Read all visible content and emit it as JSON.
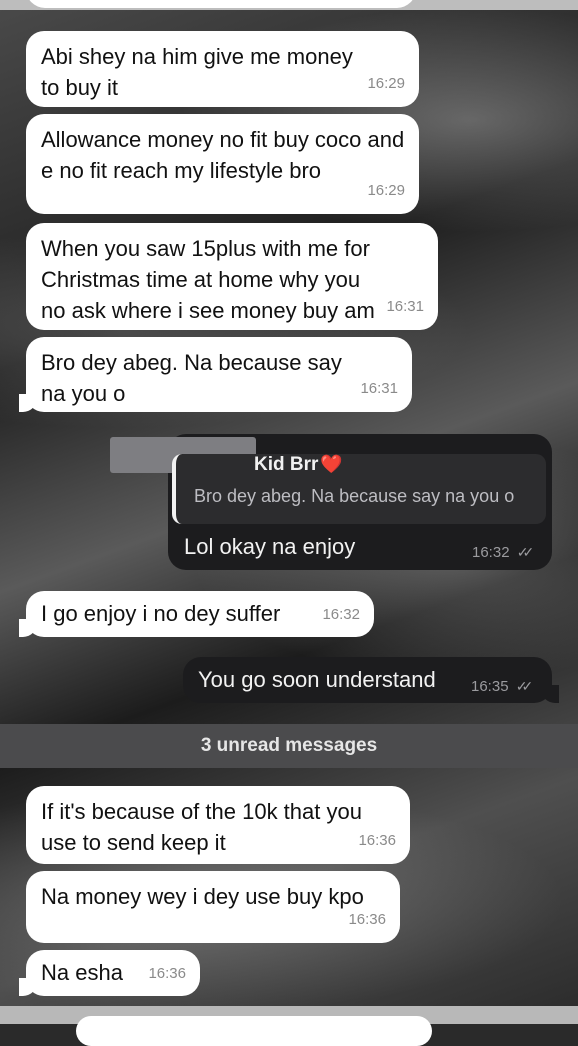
{
  "messages": [
    {
      "text": "Abi shey na him give me money to buy it",
      "time": "16:29"
    },
    {
      "text": "Allowance money no fit buy coco and e no fit reach my lifestyle bro",
      "time": "16:29"
    },
    {
      "text": "When you saw 15plus with me for Christmas time at home why you no ask where i see money buy am",
      "time": "16:31"
    },
    {
      "text": "Bro dey abeg. Na because say na you o",
      "time": "16:31"
    },
    {
      "text": "I go enjoy i no dey suffer",
      "time": "16:32"
    },
    {
      "text": "If it's because of the 10k that you use to send keep it",
      "time": "16:36"
    },
    {
      "text": "Na money wey i dey use buy kpo",
      "time": "16:36"
    },
    {
      "text": "Na esha",
      "time": "16:36"
    }
  ],
  "outgoing": [
    {
      "reply_to_name": "Kid Brr",
      "reply_to_text": "Bro dey abeg. Na because say na you o",
      "text": "Lol okay na enjoy",
      "time": "16:32"
    },
    {
      "text": "You go soon understand",
      "time": "16:35"
    }
  ],
  "unread_label": "3 unread messages",
  "colors": {
    "incoming_bg": "#ffffff",
    "outgoing_bg": "#1c1c1e",
    "heart": "#e0245e"
  },
  "icons": {
    "read_receipt": "double-check-icon",
    "heart": "heart-emoji"
  }
}
